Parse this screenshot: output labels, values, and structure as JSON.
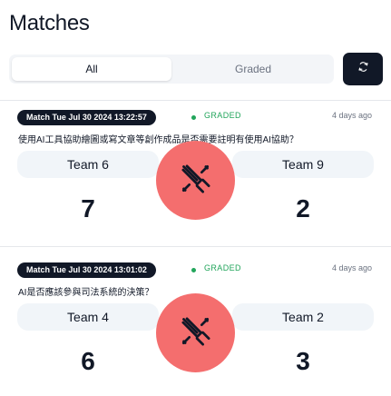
{
  "header": {
    "title": "Matches"
  },
  "tabs": [
    {
      "label": "All",
      "selected": true
    },
    {
      "label": "Graded",
      "selected": false
    }
  ],
  "refresh": {
    "icon": "refresh-icon"
  },
  "matches": [
    {
      "badge": "Match Tue Jul 30 2024 13:22:57",
      "status": "GRADED",
      "time_ago": "4 days ago",
      "question": "使用AI工具協助繪圖或寫文章等創作成品是否需要註明有使用AI協助？",
      "team_left": "Team 6",
      "team_right": "Team 9",
      "score_left": "7",
      "score_right": "2",
      "versus_icon": "swords-icon"
    },
    {
      "badge": "Match Tue Jul 30 2024 13:01:02",
      "status": "GRADED",
      "time_ago": "4 days ago",
      "question": "AI是否應該參與司法系統的決策？",
      "team_left": "Team 4",
      "team_right": "Team 2",
      "score_left": "6",
      "score_right": "3",
      "versus_icon": "swords-icon"
    }
  ],
  "colors": {
    "accent": "#111827",
    "graded": "#22a55b",
    "versus": "#f46e6e",
    "pill": "#f1f5f9"
  }
}
